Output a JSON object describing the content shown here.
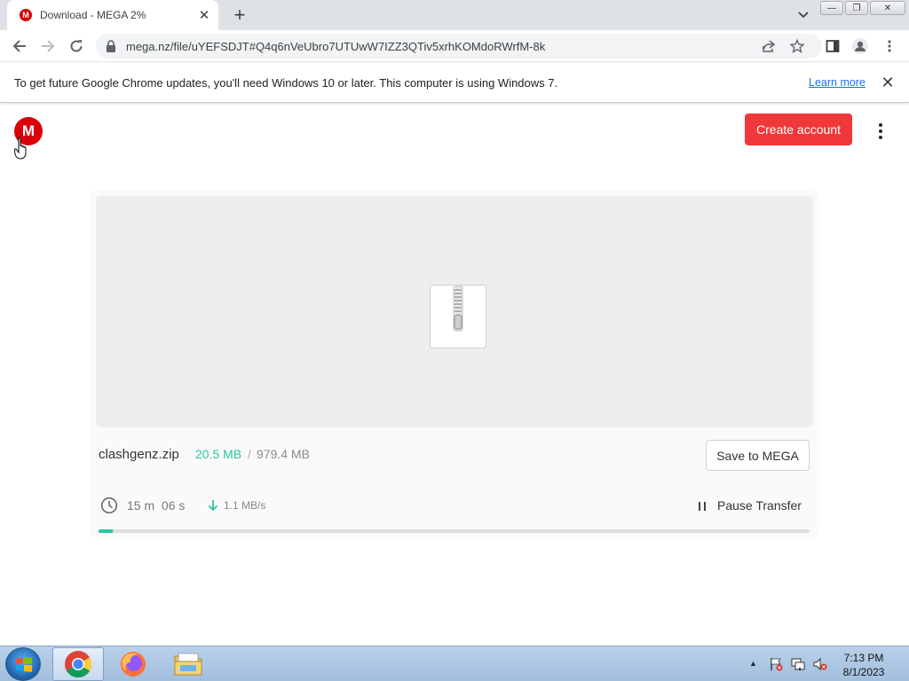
{
  "browser": {
    "tab_title": "Download - MEGA 2%",
    "tab_favicon": "M",
    "url": "mega.nz/file/uYEFSDJT#Q4q6nVeUbro7UTUwW7IZZ3QTiv5xrhKOMdoRWrfM-8k"
  },
  "infobar": {
    "message": "To get future Google Chrome updates, you'll need Windows 10 or later. This computer is using Windows 7.",
    "link": "Learn more"
  },
  "page": {
    "logo_letter": "M",
    "create_account": "Create account",
    "file": {
      "name": "clashgenz.zip",
      "downloaded": "20.5 MB",
      "separator": "/",
      "total": "979.4 MB"
    },
    "save_button": "Save to MEGA",
    "time_remaining": "15 m  06 s",
    "speed": "1.1 MB/s",
    "pause_label": "Pause Transfer",
    "progress_percent": 2,
    "accent_color": "#2bc6a1",
    "brand_color": "#d90007"
  },
  "taskbar": {
    "time": "7:13 PM",
    "date": "8/1/2023",
    "apps": [
      "chrome-icon",
      "firefox-icon",
      "file-explorer-icon"
    ]
  }
}
